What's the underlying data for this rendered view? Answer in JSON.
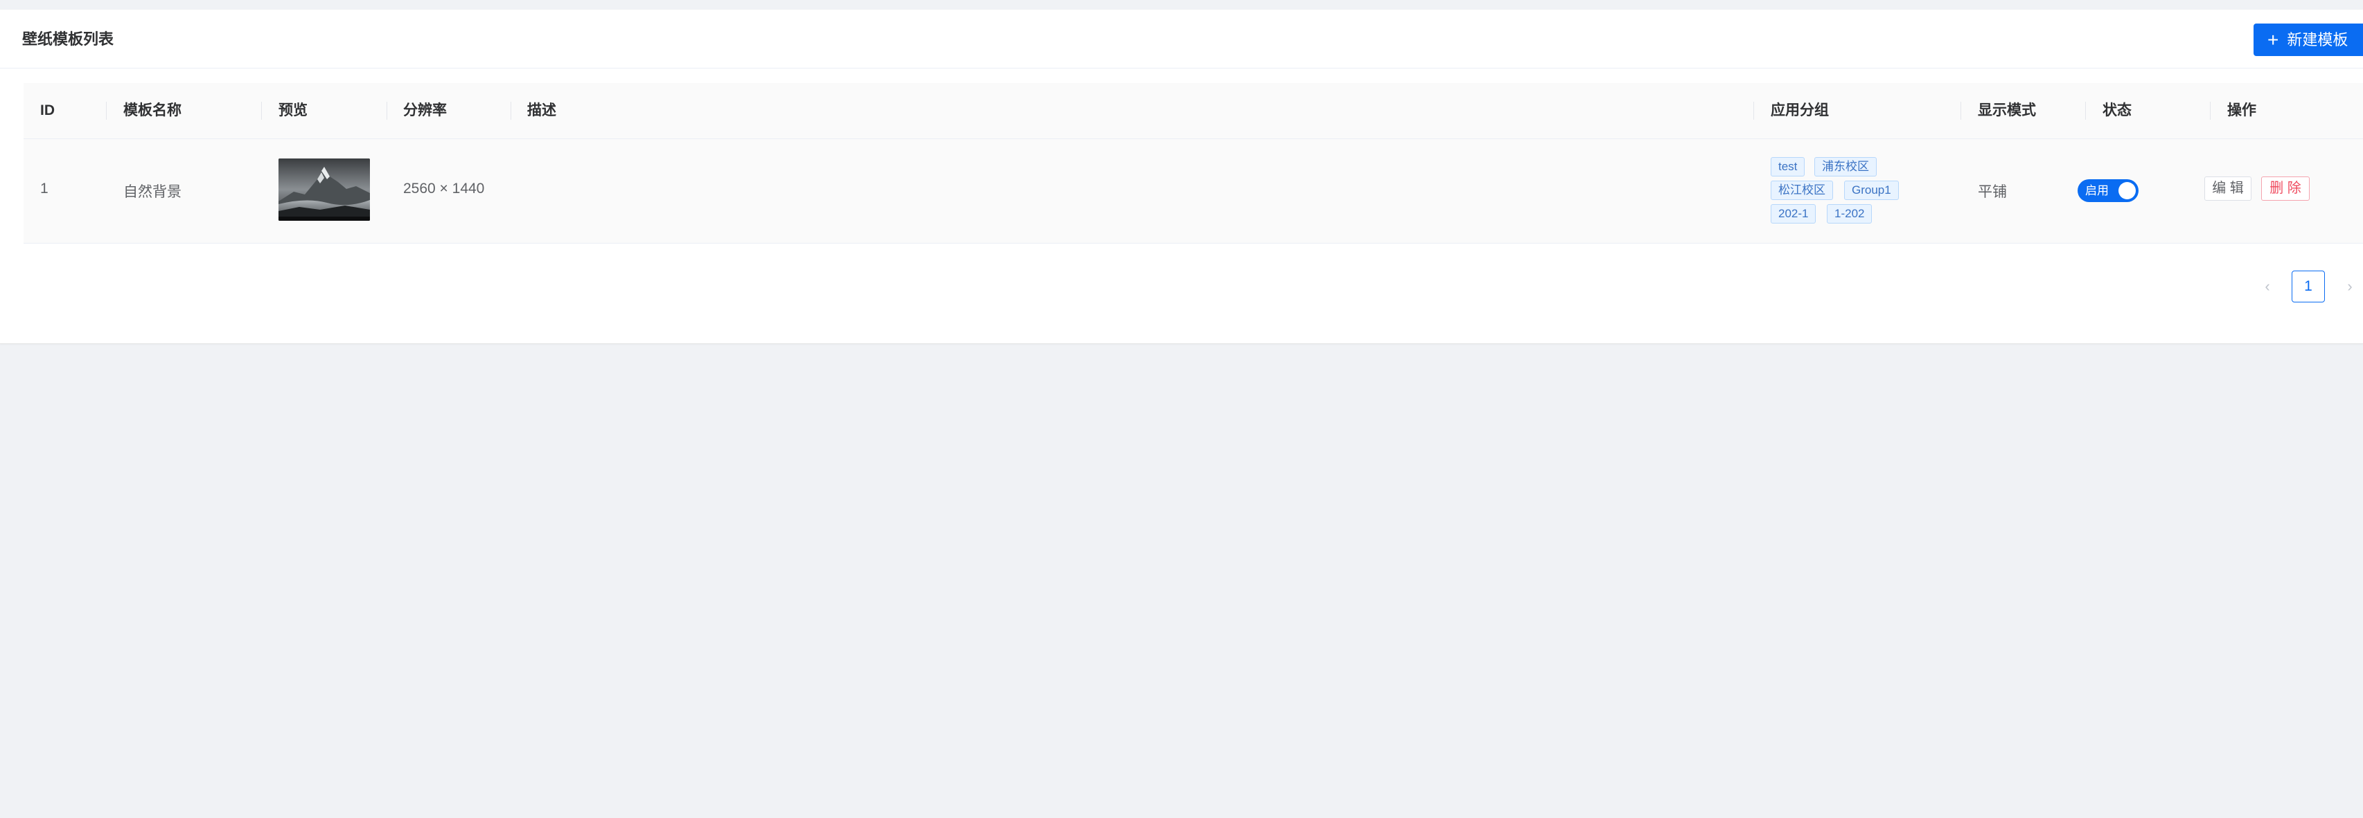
{
  "header": {
    "title": "壁纸模板列表",
    "create_label": "新建模板"
  },
  "table": {
    "columns": [
      "ID",
      "模板名称",
      "预览",
      "分辨率",
      "描述",
      "应用分组",
      "显示模式",
      "状态",
      "操作"
    ],
    "rows": [
      {
        "id": "1",
        "name": "自然背景",
        "preview_icon": "mountain-image",
        "resolution": "2560 × 1440",
        "description": "",
        "groups": [
          "test",
          "浦东校区",
          "松江校区",
          "Group1",
          "202-1",
          "1-202"
        ],
        "display_mode": "平铺",
        "status_label": "启用",
        "status_on": true,
        "edit_label": "编 辑",
        "delete_label": "删 除"
      }
    ]
  },
  "pagination": {
    "current_page": "1",
    "prev_icon": "chevron-left-icon",
    "next_icon": "chevron-right-icon"
  },
  "colors": {
    "primary": "#0a6cf2",
    "danger": "#ef4b5f",
    "tag_bg": "#e8f3ff",
    "page_bg": "#f0f2f5"
  }
}
